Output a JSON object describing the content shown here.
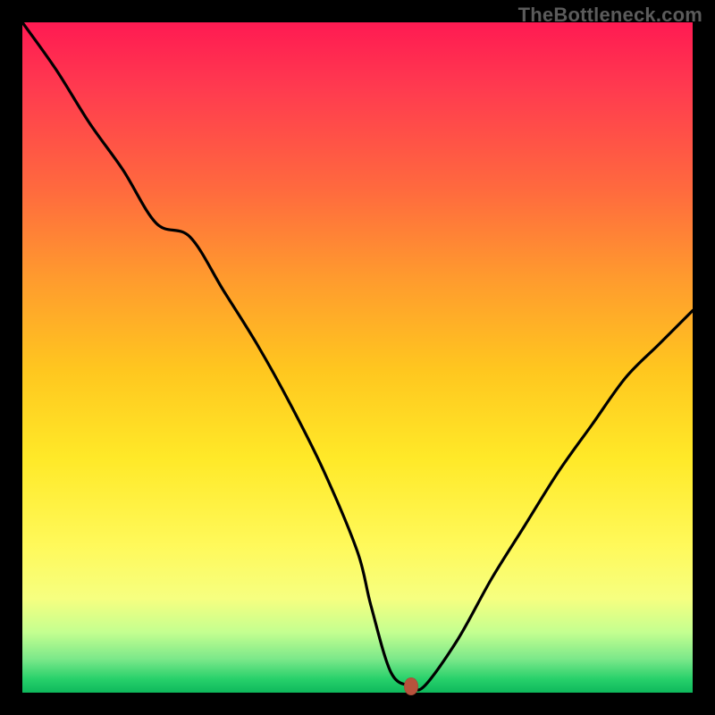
{
  "watermark": "TheBottleneck.com",
  "colors": {
    "frame_bg": "#000000",
    "watermark": "#5b5b5b",
    "curve": "#000000",
    "marker": "#b7523c",
    "gradient_top": "#ff1a52",
    "gradient_bottom": "#0eb85c"
  },
  "chart_data": {
    "type": "line",
    "title": "",
    "xlabel": "",
    "ylabel": "",
    "xlim": [
      0,
      100
    ],
    "ylim": [
      0,
      100
    ],
    "series": [
      {
        "name": "bottleneck-curve",
        "x": [
          0,
          5,
          10,
          15,
          20,
          25,
          30,
          35,
          40,
          45,
          50,
          52,
          55,
          58,
          60,
          65,
          70,
          75,
          80,
          85,
          90,
          95,
          100
        ],
        "y": [
          100,
          93,
          85,
          78,
          70,
          68,
          60,
          52,
          43,
          33,
          21,
          13,
          3,
          1,
          1,
          8,
          17,
          25,
          33,
          40,
          47,
          52,
          57
        ]
      }
    ],
    "annotations": [
      {
        "name": "optimal-marker",
        "x": 58,
        "y": 1
      }
    ]
  }
}
